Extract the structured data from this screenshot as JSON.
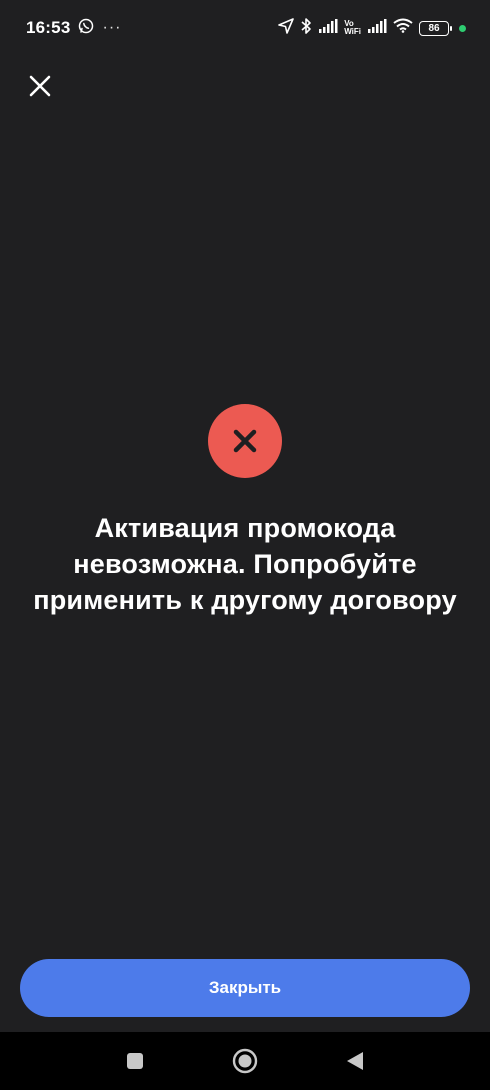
{
  "status_bar": {
    "time": "16:53",
    "overflow": "···",
    "vowifi_top": "Vo",
    "vowifi_bottom": "WiFi",
    "battery": "86"
  },
  "dialog": {
    "close_icon": "close-icon",
    "status_icon": "error-x-icon",
    "status_color": "#ec5a52",
    "message": "Активация промокода невозможна. Попробуйте применить к другому договору",
    "close_button_label": "Закрыть",
    "accent_color": "#4d7bea"
  },
  "nav_bar": {
    "recents": "square-icon",
    "home": "circle-icon",
    "back": "triangle-back-icon"
  }
}
